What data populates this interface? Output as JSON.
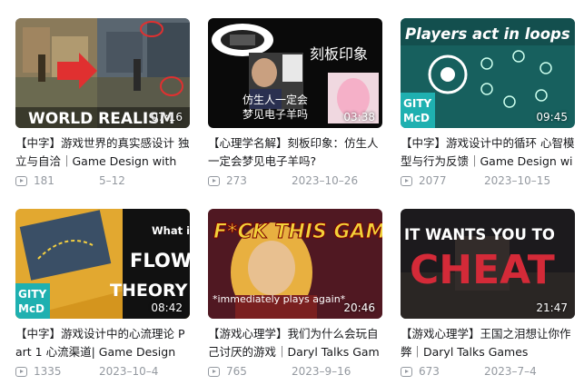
{
  "videos": [
    {
      "title": "【中字】游戏世界的真实感设计 独立与自洽｜Game Design with",
      "duration": "07:16",
      "views": "181",
      "date": "5–12",
      "thumb_text": "WORLD REALISM"
    },
    {
      "title": "【心理学名解】刻板印象：仿生人一定会梦见电子羊吗?",
      "duration": "03:38",
      "views": "273",
      "date": "2023–10–26",
      "thumb_text_1": "刻板印象",
      "thumb_text_2": "仿生人一定会",
      "thumb_text_3": "梦见电子羊吗"
    },
    {
      "title": "【中字】游戏设计中的循环 心智模型与行为反馈｜Game Design with",
      "duration": "09:45",
      "views": "2077",
      "date": "2023–10–15",
      "thumb_text_1": "Players act in loops",
      "thumb_text_2": "GITY",
      "thumb_text_3": "McD"
    },
    {
      "title": "【中字】游戏设计中的心流理论 Part 1 心流渠道| Game Design",
      "duration": "08:42",
      "views": "1335",
      "date": "2023–10–4",
      "thumb_text_1": "What is",
      "thumb_text_2": "FLOW",
      "thumb_text_3": "THEORY",
      "thumb_text_4": "GITY",
      "thumb_text_5": "McD"
    },
    {
      "title": "【游戏心理学】我们为什么会玩自己讨厌的游戏｜Daryl Talks Games",
      "duration": "20:46",
      "views": "765",
      "date": "2023–9–16",
      "thumb_text_1": "F*CK THIS GAME",
      "thumb_text_2": "*immediately plays again*"
    },
    {
      "title": "【游戏心理学】王国之泪想让你作弊｜Daryl Talks Games",
      "duration": "21:47",
      "views": "673",
      "date": "2023–7–4",
      "thumb_text_1": "IT WANTS YOU TO",
      "thumb_text_2": "CHEAT"
    }
  ]
}
